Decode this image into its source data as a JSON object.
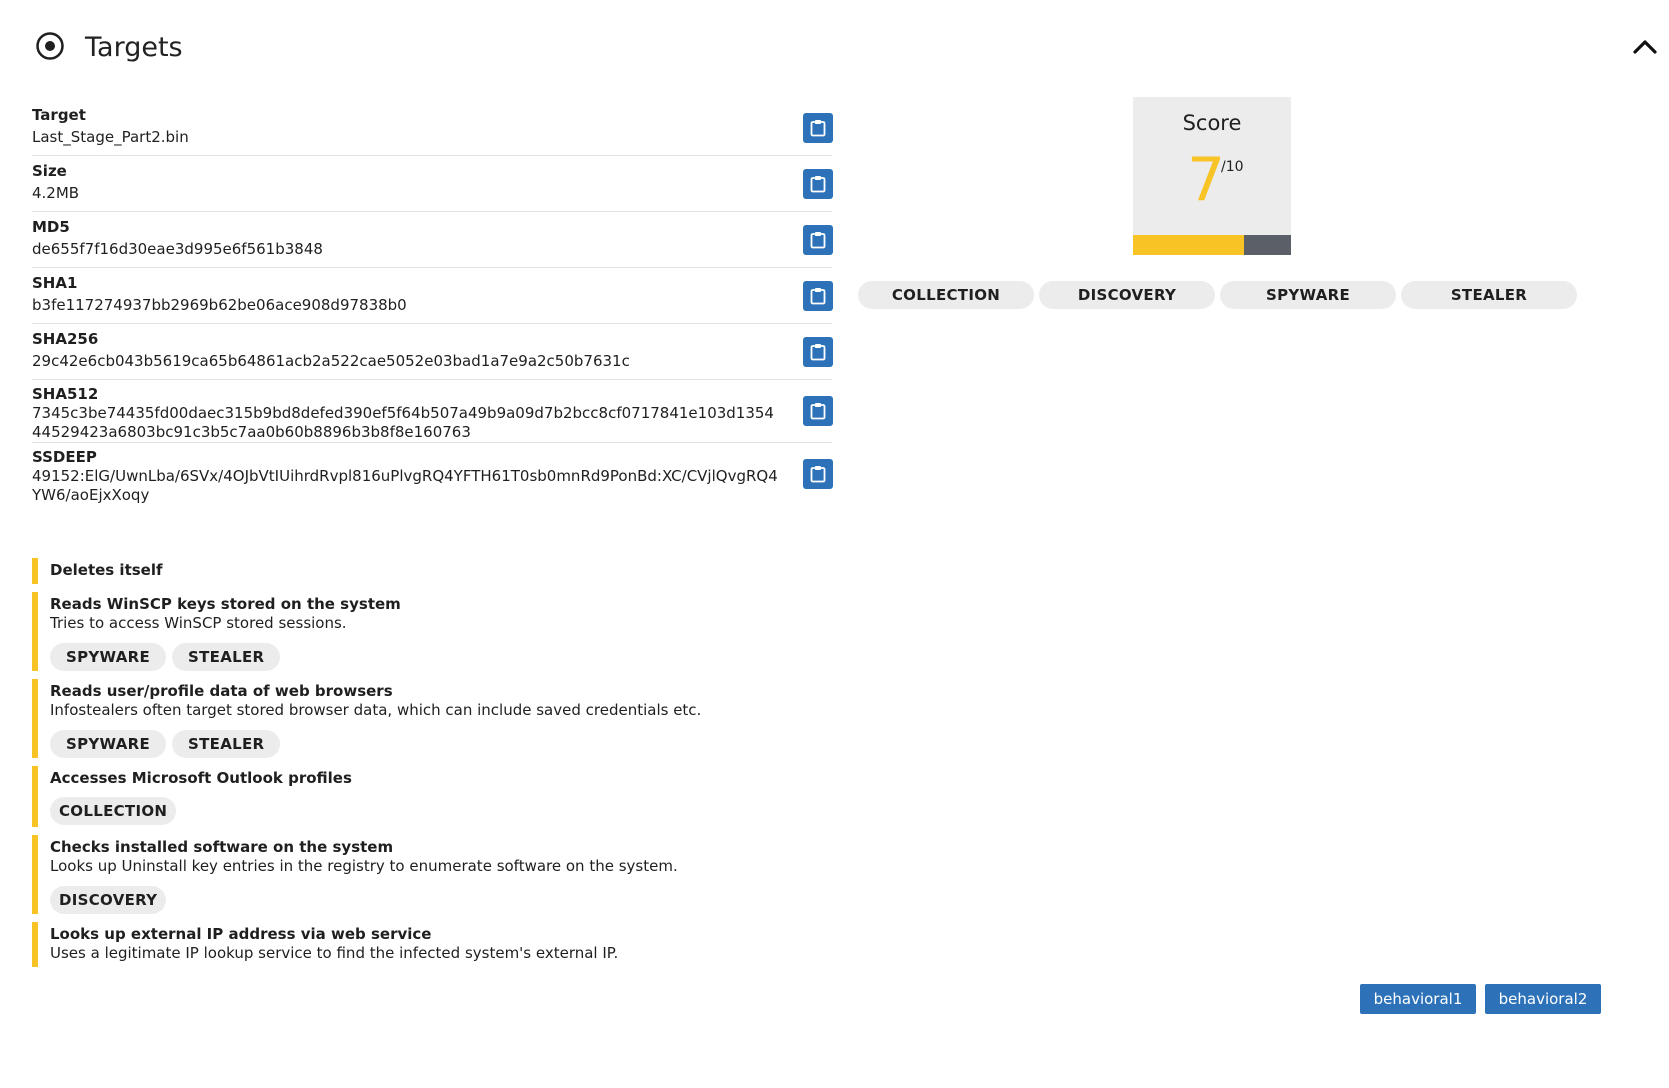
{
  "header": {
    "title": "Targets",
    "icon": "target-icon",
    "collapse_icon": "chevron-up-icon"
  },
  "properties": [
    {
      "label": "Target",
      "value": "Last_Stage_Part2.bin"
    },
    {
      "label": "Size",
      "value": "4.2MB"
    },
    {
      "label": "MD5",
      "value": "de655f7f16d30eae3d995e6f561b3848"
    },
    {
      "label": "SHA1",
      "value": "b3fe117274937bb2969b62be06ace908d97838b0"
    },
    {
      "label": "SHA256",
      "value": "29c42e6cb043b5619ca65b64861acb2a522cae5052e03bad1a7e9a2c50b7631c"
    },
    {
      "label": "SHA512",
      "value": "7345c3be74435fd00daec315b9bd8defed390ef5f64b507a49b9a09d7b2bcc8cf0717841e103d135444529423a6803bc91c3b5c7aa0b60b8896b3b8f8e160763"
    },
    {
      "label": "SSDEEP",
      "value": "49152:ElG/UwnLba/6SVx/4OJbVtIUihrdRvpl816uPlvgRQ4YFTH61T0sb0mnRd9PonBd:XC/CVjlQvgRQ4YW6/aoEjxXoqy"
    }
  ],
  "signatures": [
    {
      "title": "Deletes itself",
      "description": "",
      "tags": []
    },
    {
      "title": "Reads WinSCP keys stored on the system",
      "description": "Tries to access WinSCP stored sessions.",
      "tags": [
        "SPYWARE",
        "STEALER"
      ]
    },
    {
      "title": "Reads user/profile data of web browsers",
      "description": "Infostealers often target stored browser data, which can include saved credentials etc.",
      "tags": [
        "SPYWARE",
        "STEALER"
      ]
    },
    {
      "title": "Accesses Microsoft Outlook profiles",
      "description": "",
      "tags": [
        "COLLECTION"
      ]
    },
    {
      "title": "Checks installed software on the system",
      "description": "Looks up Uninstall key entries in the registry to enumerate software on the system.",
      "tags": [
        "DISCOVERY"
      ]
    },
    {
      "title": "Looks up external IP address via web service",
      "description": "Uses a legitimate IP lookup service to find the infected system's external IP.",
      "tags": []
    }
  ],
  "score": {
    "label": "Score",
    "value": "7",
    "max": "/10",
    "fraction": 0.7,
    "colors": {
      "fill": "#f7c325",
      "track": "#5a5f68"
    }
  },
  "score_tags": [
    "COLLECTION",
    "DISCOVERY",
    "SPYWARE",
    "STEALER"
  ],
  "buttons": [
    {
      "label": "behavioral1"
    },
    {
      "label": "behavioral2"
    }
  ],
  "colors": {
    "accent": "#2d72b8",
    "severity": "#f7c325"
  }
}
